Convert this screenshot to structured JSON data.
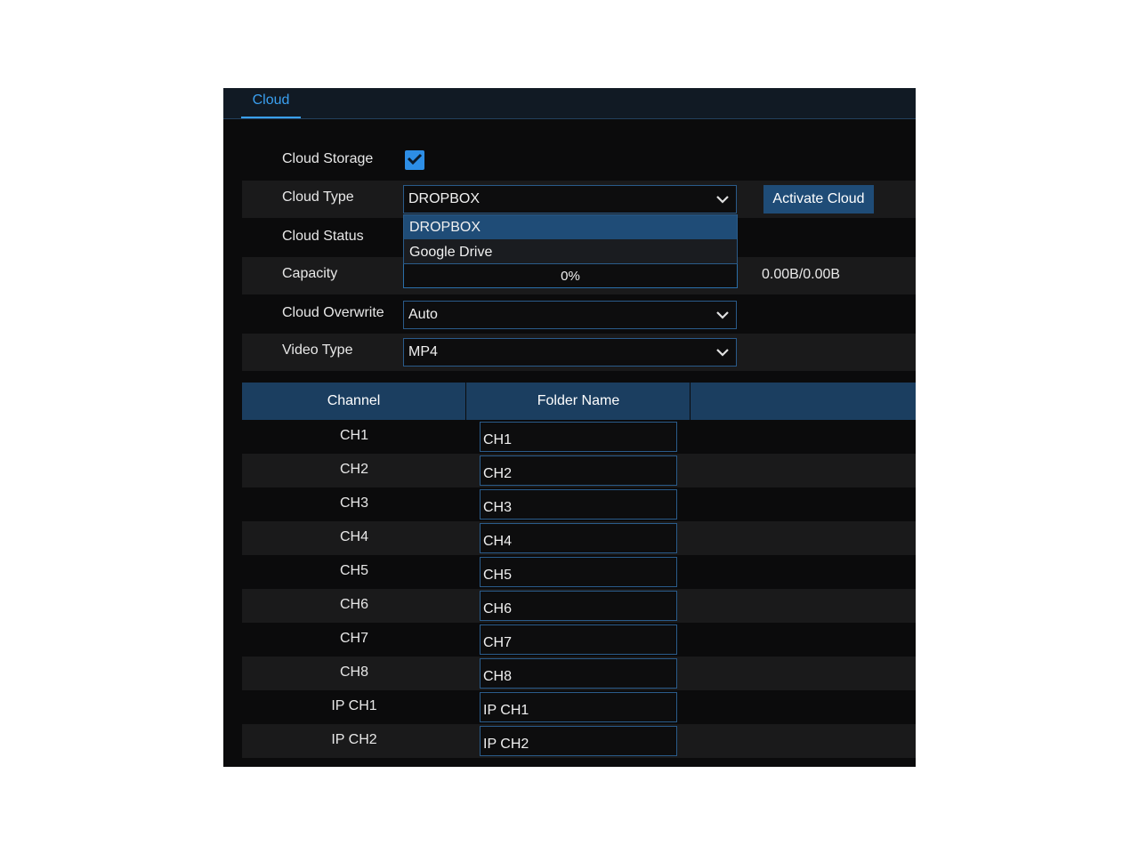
{
  "tabs": [
    {
      "label": "Cloud",
      "active": true
    }
  ],
  "form": {
    "cloud_storage": {
      "label": "Cloud Storage",
      "checked": true
    },
    "cloud_type": {
      "label": "Cloud Type",
      "value": "DROPBOX",
      "options": [
        "DROPBOX",
        "Google Drive"
      ],
      "activate_label": "Activate Cloud"
    },
    "cloud_status": {
      "label": "Cloud Status"
    },
    "capacity": {
      "label": "Capacity",
      "percent_text": "0%",
      "percent": 0,
      "size_text": "0.00B/0.00B"
    },
    "cloud_overwrite": {
      "label": "Cloud Overwrite",
      "value": "Auto"
    },
    "video_type": {
      "label": "Video Type",
      "value": "MP4"
    }
  },
  "table": {
    "headers": [
      "Channel",
      "Folder Name",
      ""
    ],
    "rows": [
      {
        "channel": "CH1",
        "folder": "CH1"
      },
      {
        "channel": "CH2",
        "folder": "CH2"
      },
      {
        "channel": "CH3",
        "folder": "CH3"
      },
      {
        "channel": "CH4",
        "folder": "CH4"
      },
      {
        "channel": "CH5",
        "folder": "CH5"
      },
      {
        "channel": "CH6",
        "folder": "CH6"
      },
      {
        "channel": "CH7",
        "folder": "CH7"
      },
      {
        "channel": "CH8",
        "folder": "CH8"
      },
      {
        "channel": "IP CH1",
        "folder": "IP CH1"
      },
      {
        "channel": "IP CH2",
        "folder": "IP CH2"
      }
    ]
  },
  "colors": {
    "accent": "#2d8ee6",
    "header": "#1b3e60",
    "button": "#1f4c77",
    "background": "#0b0b0c"
  }
}
